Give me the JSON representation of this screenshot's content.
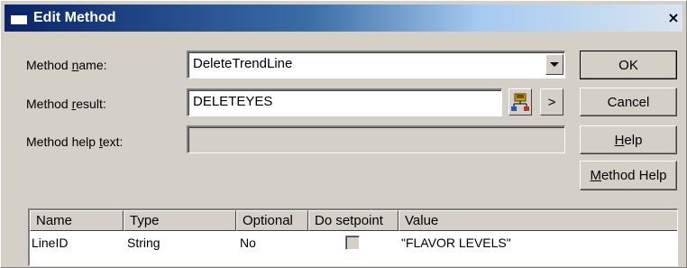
{
  "window": {
    "title": "Edit Method",
    "close_glyph": "×"
  },
  "form": {
    "method_name_label": "Method name:",
    "method_name_value": "DeleteTrendLine",
    "method_result_label": "Method result:",
    "method_result_value": "DELETEYES",
    "method_help_label": "Method help text:",
    "method_help_value": ""
  },
  "buttons": {
    "ok": "OK",
    "cancel": "Cancel",
    "help": "Help",
    "method_help": "Method Help",
    "arrow": ">"
  },
  "table": {
    "columns": [
      "Name",
      "Type",
      "Optional",
      "Do setpoint",
      "Value"
    ],
    "rows": [
      {
        "name": "LineID",
        "type": "String",
        "optional": "No",
        "do_setpoint": false,
        "value": "\"FLAVOR LEVELS\""
      }
    ]
  },
  "colors": {
    "face": "#d4d0c8",
    "title_start": "#0a246a",
    "title_end": "#a6caf0"
  },
  "icons": {
    "dropdown": "chevron-down-icon",
    "tag_browser": "tag-browser-icon",
    "close": "close-icon"
  }
}
